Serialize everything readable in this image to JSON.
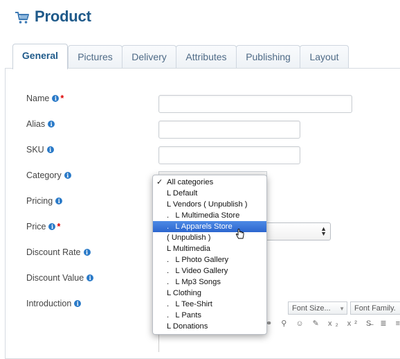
{
  "header": {
    "title": "Product",
    "icon": "cart-icon"
  },
  "tabs": [
    {
      "label": "General",
      "active": true
    },
    {
      "label": "Pictures"
    },
    {
      "label": "Delivery"
    },
    {
      "label": "Attributes"
    },
    {
      "label": "Publishing"
    },
    {
      "label": "Layout"
    }
  ],
  "form": {
    "name_label": "Name",
    "alias_label": "Alias",
    "sku_label": "SKU",
    "category_label": "Category",
    "pricing_label": "Pricing",
    "price_label": "Price",
    "discount_rate_label": "Discount Rate",
    "discount_value_label": "Discount Value",
    "introduction_label": "Introduction",
    "required_mark": "*",
    "info_glyph": "i"
  },
  "category_dropdown": {
    "check_mark": "✓",
    "items": [
      "All categories",
      "L Default",
      "L Vendors ( Unpublish )",
      ".   L Multimedia Store",
      ".   L Apparels Store",
      "( Unpublish )",
      "L Multimedia",
      ".   L Photo Gallery",
      ".   L Video Gallery",
      ".   L Mp3 Songs",
      "L Clothing",
      ".   L Tee-Shirt",
      ".   L Pants",
      "L Donations"
    ],
    "selected_index": 4,
    "checked_index": 0
  },
  "editor_toolbar": {
    "font_size_label": "Font Size...",
    "font_family_label": "Font Family."
  },
  "colors": {
    "title": "#1f5a8a",
    "tab_text": "#4e6a86",
    "highlight": "#3875d7",
    "info": "#2a7ac8",
    "required": "#dd0000"
  }
}
